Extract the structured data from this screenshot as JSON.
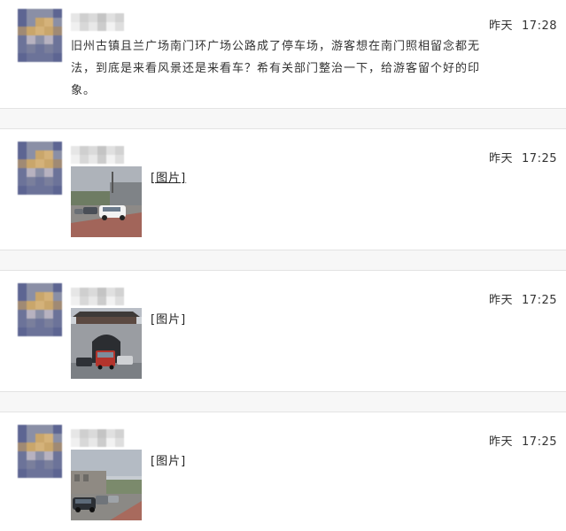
{
  "posts": [
    {
      "day": "昨天",
      "time": "17:28",
      "text": "旧州古镇且兰广场南门环广场公路成了停车场，游客想在南门照相留念都无法，到底是来看风景还是来看车？希有关部门整治一下，给游客留个好的印象。"
    },
    {
      "day": "昨天",
      "time": "17:25",
      "image_label": "[图片]",
      "image_icon": "photo-parked-cars-road"
    },
    {
      "day": "昨天",
      "time": "17:25",
      "image_label": "[图片]",
      "image_icon": "photo-city-gate-cars"
    },
    {
      "day": "昨天",
      "time": "17:25",
      "image_label": "[图片]",
      "image_icon": "photo-street-parked-cars"
    }
  ],
  "colors": {
    "separator_bg": "#f7f7f7",
    "separator_border": "#e3e3e3",
    "avatar_palette": [
      "#5d6592",
      "#8a8fa6",
      "#c9a66b",
      "#d4b27a",
      "#a08a74",
      "#6c7399",
      "#b7b2c0",
      "#7a7f9c"
    ]
  }
}
